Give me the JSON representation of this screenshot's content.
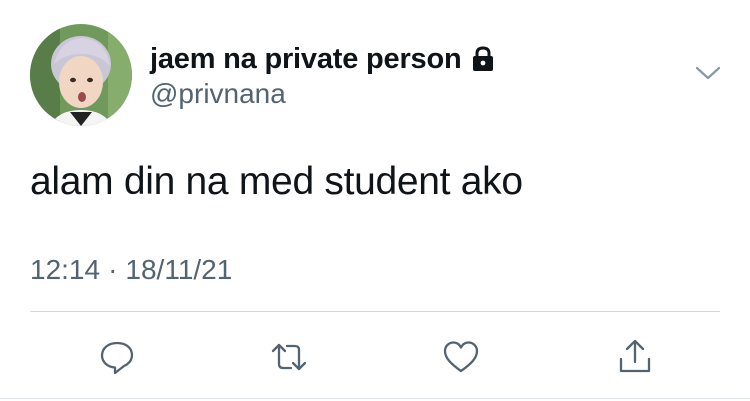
{
  "author": {
    "display_name": "jaem na private person",
    "handle": "@privnana",
    "protected_icon": "lock-icon",
    "avatar_icon": "avatar"
  },
  "tweet": {
    "text": "alam din na med student ako",
    "time": "12:14",
    "separator": "·",
    "date": "18/11/21"
  },
  "actions": {
    "reply_icon": "reply-icon",
    "retweet_icon": "retweet-icon",
    "like_icon": "heart-icon",
    "share_icon": "share-icon",
    "menu_icon": "chevron-down-icon"
  },
  "colors": {
    "text_primary": "#0f1419",
    "text_secondary": "#536471",
    "divider": "#cfd9de"
  }
}
